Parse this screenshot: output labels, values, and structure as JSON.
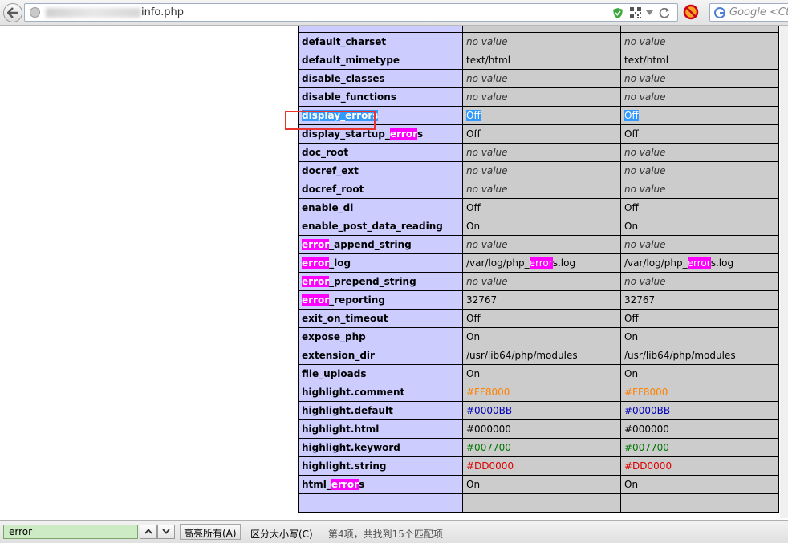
{
  "toolbar": {
    "url": "info.php",
    "search_placeholder": "Google <Ctrl+K>"
  },
  "config_rows": [
    {
      "name": "default_charset",
      "local": "no value",
      "master": "no value"
    },
    {
      "name": "default_mimetype",
      "local": "text/html",
      "master": "text/html"
    },
    {
      "name": "disable_classes",
      "local": "no value",
      "master": "no value"
    },
    {
      "name": "disable_functions",
      "local": "no value",
      "master": "no value"
    },
    {
      "name": "display_errors",
      "local": "Off",
      "master": "Off"
    },
    {
      "name": "display_startup_errors",
      "local": "Off",
      "master": "Off"
    },
    {
      "name": "doc_root",
      "local": "no value",
      "master": "no value"
    },
    {
      "name": "docref_ext",
      "local": "no value",
      "master": "no value"
    },
    {
      "name": "docref_root",
      "local": "no value",
      "master": "no value"
    },
    {
      "name": "enable_dl",
      "local": "Off",
      "master": "Off"
    },
    {
      "name": "enable_post_data_reading",
      "local": "On",
      "master": "On"
    },
    {
      "name": "error_append_string",
      "local": "no value",
      "master": "no value"
    },
    {
      "name": "error_log",
      "local": "/var/log/php_errors.log",
      "master": "/var/log/php_errors.log"
    },
    {
      "name": "error_prepend_string",
      "local": "no value",
      "master": "no value"
    },
    {
      "name": "error_reporting",
      "local": "32767",
      "master": "32767"
    },
    {
      "name": "exit_on_timeout",
      "local": "Off",
      "master": "Off"
    },
    {
      "name": "expose_php",
      "local": "On",
      "master": "On"
    },
    {
      "name": "extension_dir",
      "local": "/usr/lib64/php/modules",
      "master": "/usr/lib64/php/modules"
    },
    {
      "name": "file_uploads",
      "local": "On",
      "master": "On"
    },
    {
      "name": "highlight.comment",
      "local": "#FF8000",
      "master": "#FF8000",
      "color": "#FF8000"
    },
    {
      "name": "highlight.default",
      "local": "#0000BB",
      "master": "#0000BB",
      "color": "#0000BB"
    },
    {
      "name": "highlight.html",
      "local": "#000000",
      "master": "#000000",
      "color": "#000000"
    },
    {
      "name": "highlight.keyword",
      "local": "#007700",
      "master": "#007700",
      "color": "#007700"
    },
    {
      "name": "highlight.string",
      "local": "#DD0000",
      "master": "#DD0000",
      "color": "#DD0000"
    },
    {
      "name": "html_errors",
      "local": "On",
      "master": "On"
    }
  ],
  "find": {
    "term": "error",
    "highlight_all_label": "高亮所有(A)",
    "match_case_label": "区分大小写(C)",
    "status": "第4项，共找到15个匹配项"
  },
  "colors": {
    "entry_bg": "#ccccff",
    "value_bg": "#cccccc",
    "match_highlight": "#ff00ff",
    "selection": "#3399ff",
    "callout_border": "#e8332e"
  }
}
